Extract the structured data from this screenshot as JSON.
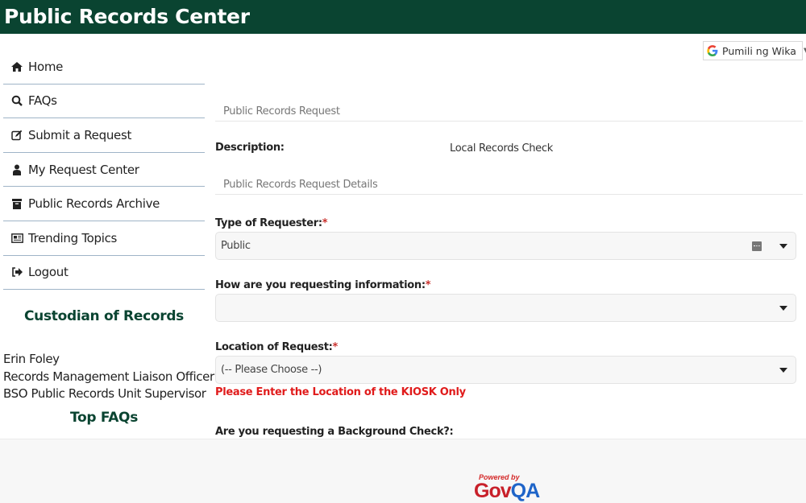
{
  "header": {
    "title": "Public Records Center"
  },
  "translate": {
    "label": "Pumili ng Wika",
    "icon": "google-g-icon",
    "arrow": "▼"
  },
  "sidebar": {
    "items": [
      {
        "label": "Home",
        "icon": "home-icon"
      },
      {
        "label": "FAQs",
        "icon": "search-icon"
      },
      {
        "label": "Submit a Request",
        "icon": "edit-icon"
      },
      {
        "label": "My Request Center",
        "icon": "user-icon"
      },
      {
        "label": "Public Records Archive",
        "icon": "archive-icon"
      },
      {
        "label": "Trending Topics",
        "icon": "newspaper-icon"
      },
      {
        "label": "Logout",
        "icon": "sign-out-icon"
      }
    ],
    "custodian": {
      "title": "Custodian of Records",
      "name": "Erin Foley",
      "role": "Records Management Liaison Officer",
      "unit": "BSO Public Records Unit Supervisor"
    },
    "top_faqs_title": "Top FAQs"
  },
  "main": {
    "section1": "Public Records Request",
    "description_label": "Description:",
    "description_value": "Local Records Check",
    "section2": "Public Records Request Details",
    "fields": [
      {
        "label": "Type of Requester:",
        "required_mark": "*",
        "value": "Public"
      },
      {
        "label": "How are you requesting information:",
        "required_mark": "*",
        "value": ""
      },
      {
        "label": "Location of Request:",
        "required_mark": "*",
        "value": "(-- Please Choose --)"
      }
    ],
    "location_hint": "Please Enter the Location of the KIOSK Only",
    "background_check_label": "Are you requesting a Background Check?:"
  },
  "footer": {
    "powered_by": "Powered by",
    "brand_gov": "Gov",
    "brand_qa": "QA"
  },
  "colors": {
    "header_bg": "#0a4431",
    "accent_green": "#0a4431",
    "required": "#c9302c",
    "hint_red": "#e01b1b"
  }
}
